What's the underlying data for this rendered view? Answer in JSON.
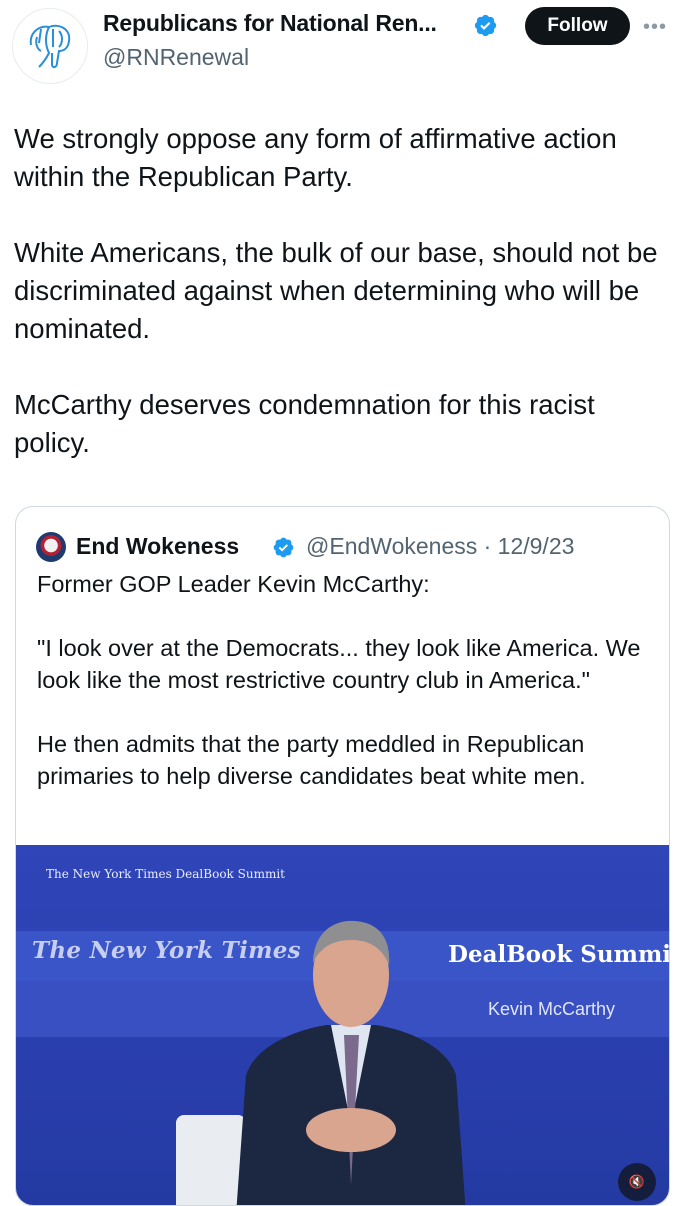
{
  "author": {
    "display_name": "Republicans for National Ren...",
    "handle": "@RNRenewal",
    "avatar_icon": "elephant-logo-icon",
    "verified": true,
    "follow_label": "Follow",
    "more_icon": "more-options-icon"
  },
  "tweet": {
    "text": "We strongly oppose any form of affirmative action within the Republican Party.\n\nWhite Americans, the bulk of our base, should not be discriminated against when determining who will be nominated.\n\nMcCarthy deserves condemnation for this racist policy."
  },
  "quoted_tweet": {
    "display_name": "End Wokeness",
    "handle_date": "@EndWokeness · 12/9/23",
    "verified": true,
    "text": "Former GOP Leader Kevin McCarthy:\n\n\"I look over at the Democrats... they look like America. We look like the most restrictive country club in America.\"\n\nHe then admits that the party meddled in Republican primaries to help diverse candidates beat white men.",
    "media": {
      "caption_small": "The New York Times DealBook Summit",
      "banner_left": "The New York Times",
      "banner_right": "DealBook Summit",
      "lower_third_name": "Kevin McCarthy",
      "mute_label": "🔇"
    }
  },
  "colors": {
    "accent": "#1d9bf0",
    "text": "#0f1419",
    "secondary_text": "#536471",
    "stage_blue": "#2f45b8"
  }
}
